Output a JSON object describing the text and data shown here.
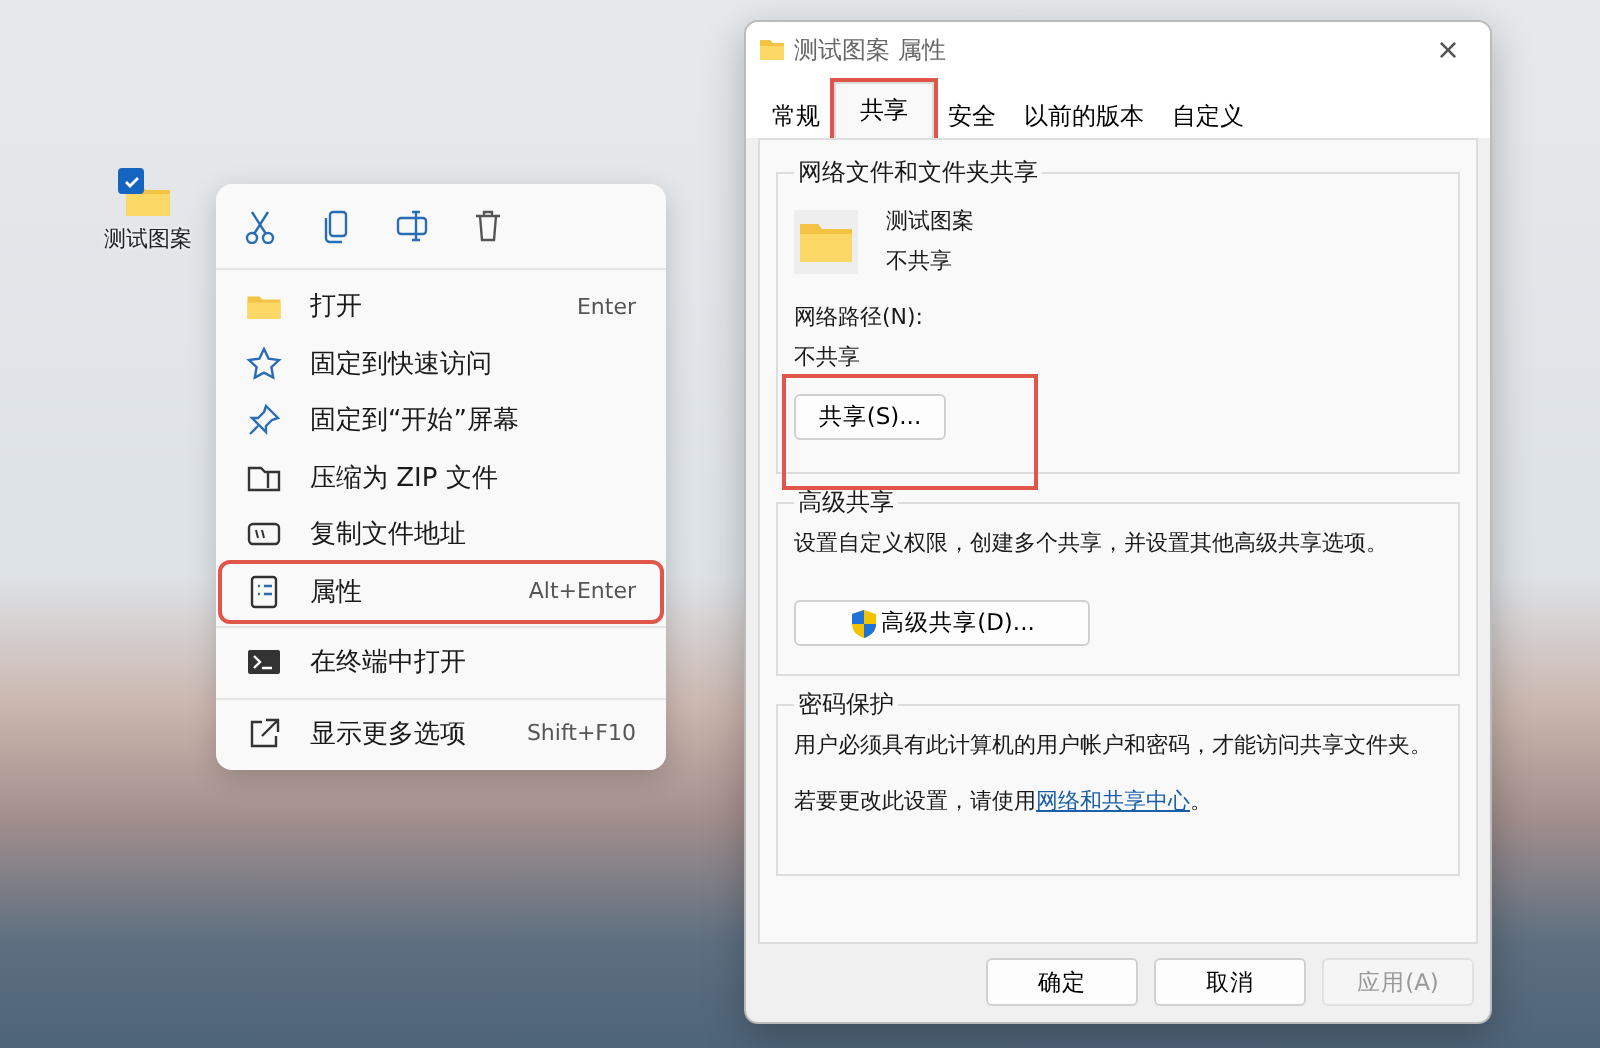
{
  "desktop_icon": {
    "label": "测试图案",
    "checked": true
  },
  "context_menu": {
    "toolbar": [
      {
        "kind": "cut"
      },
      {
        "kind": "copy"
      },
      {
        "kind": "rename"
      },
      {
        "kind": "delete"
      }
    ],
    "items": [
      {
        "label": "打开",
        "shortcut": "Enter",
        "highlighted": false
      },
      {
        "label": "固定到快速访问",
        "highlighted": false
      },
      {
        "label": "固定到“开始”屏幕",
        "highlighted": false
      },
      {
        "label": "压缩为 ZIP 文件",
        "highlighted": false
      },
      {
        "label": "复制文件地址",
        "highlighted": false
      },
      {
        "label": "属性",
        "shortcut": "Alt+Enter",
        "highlighted": true
      },
      {
        "label": "在终端中打开",
        "highlighted": false
      },
      {
        "label": "显示更多选项",
        "shortcut": "Shift+F10",
        "highlighted": false
      }
    ]
  },
  "dialog": {
    "title": "测试图案 属性",
    "close": "×",
    "tabs": [
      {
        "label": "常规",
        "selected": false,
        "highlighted": false
      },
      {
        "label": "共享",
        "selected": true,
        "highlighted": true
      },
      {
        "label": "安全",
        "selected": false,
        "highlighted": false
      },
      {
        "label": "以前的版本",
        "selected": false,
        "highlighted": false
      },
      {
        "label": "自定义",
        "selected": false,
        "highlighted": false
      }
    ],
    "network_sharing": {
      "legend": "网络文件和文件夹共享",
      "folder_name": "测试图案",
      "folder_status": "不共享",
      "path_label": "网络路径(N):",
      "path_value": "不共享",
      "share_button": "共享(S)...",
      "share_highlighted": true
    },
    "advanced_sharing": {
      "legend": "高级共享",
      "description": "设置自定义权限，创建多个共享，并设置其他高级共享选项。",
      "button": "高级共享(D)..."
    },
    "password_protection": {
      "legend": "密码保护",
      "description": "用户必须具有此计算机的用户帐户和密码，才能访问共享文件夹。",
      "link_prefix": "若要更改此设置，请使用",
      "link": "网络和共享中心",
      "link_suffix": "。"
    },
    "buttons": [
      {
        "label": "确定",
        "disabled": false
      },
      {
        "label": "取消",
        "disabled": false
      },
      {
        "label": "应用(A)",
        "disabled": true
      }
    ]
  }
}
